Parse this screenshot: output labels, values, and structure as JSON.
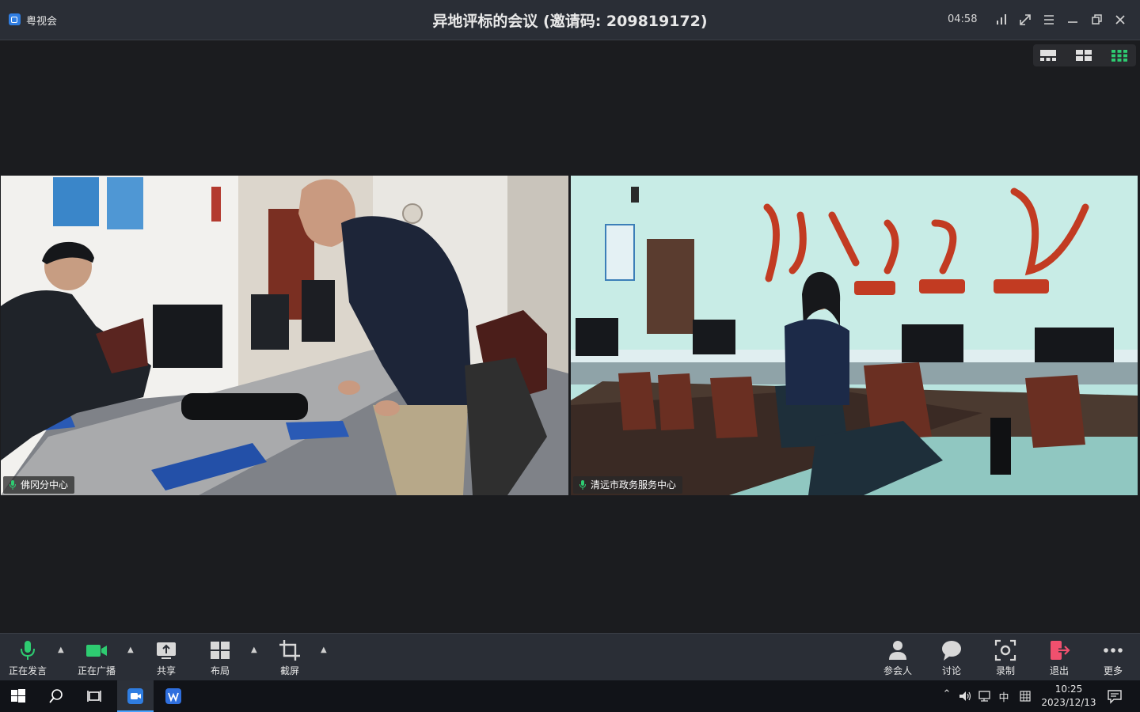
{
  "titlebar": {
    "app_name": "粤视会",
    "meeting_title": "异地评标的会议 (邀请码: 209819172)",
    "timer": "04:58",
    "icons": [
      "signal-icon",
      "fullscreen-icon",
      "menu-icon",
      "minimize-icon",
      "restore-icon",
      "close-icon"
    ]
  },
  "layout_switch": {
    "options": [
      "speaker-layout",
      "grid-4-layout",
      "grid-9-layout"
    ],
    "active": "grid-9-layout",
    "active_color": "#2ecc71"
  },
  "videos": [
    {
      "name": "佛冈分中心",
      "mic": "on"
    },
    {
      "name": "清远市政务服务中心",
      "mic": "on"
    }
  ],
  "toolbar": {
    "left": [
      {
        "label": "正在发言",
        "icon": "microphone-icon",
        "color": "#2ecc71"
      },
      {
        "label": "正在广播",
        "icon": "camera-icon",
        "color": "#2ecc71"
      },
      {
        "label": "共享",
        "icon": "share-screen-icon"
      },
      {
        "label": "布局",
        "icon": "layout-icon"
      },
      {
        "label": "截屏",
        "icon": "crop-icon"
      }
    ],
    "right": [
      {
        "label": "参会人",
        "icon": "participants-icon"
      },
      {
        "label": "讨论",
        "icon": "chat-icon"
      },
      {
        "label": "录制",
        "icon": "record-icon"
      },
      {
        "label": "退出",
        "icon": "exit-icon",
        "color": "#f0506e"
      },
      {
        "label": "更多",
        "icon": "more-icon"
      }
    ]
  },
  "taskbar": {
    "apps": [
      "start-icon",
      "search-icon",
      "task-view-icon",
      "meeting-app-icon",
      "wps-writer-icon"
    ],
    "tray": {
      "ime_mode": "中",
      "time": "10:25",
      "date": "2023/12/13"
    }
  }
}
